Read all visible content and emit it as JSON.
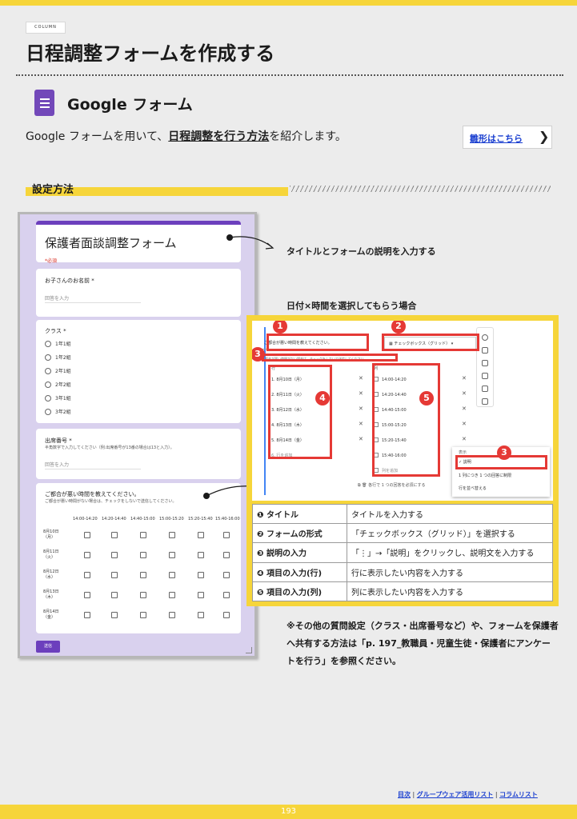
{
  "column_tag": "COLUMN",
  "page_title": "日程調整フォームを作成する",
  "app_name": "Google フォーム",
  "intro": {
    "prefix": "Google フォームを用いて、",
    "highlight": "日程調整を行う方法",
    "suffix": "を紹介します。"
  },
  "template_button": {
    "label": "雛形はこちら",
    "chevron": "❯"
  },
  "section_title": "設定方法",
  "form": {
    "title": "保護者面談調整フォーム",
    "required_note": "*必須",
    "q1": {
      "label": "お子さんのお名前 *",
      "placeholder": "回答を入力"
    },
    "q2": {
      "label": "クラス *",
      "options": [
        "1年1組",
        "1年2組",
        "2年1組",
        "2年2組",
        "3年1組",
        "3年2組"
      ]
    },
    "q3": {
      "label": "出席番号 *",
      "help": "半角数字で入力してください（例:出席番号が13番の場合は13と入力）。",
      "placeholder": "回答を入力"
    },
    "q4": {
      "label": "ご都合が悪い時間を教えてください。",
      "help": "ご都合が悪い時間がない場合は、チェックをしないで送信してください。",
      "columns": [
        "14:00-14:20",
        "14:20-14:40",
        "14:40-15:00",
        "15:00-15:20",
        "15:20-15:40",
        "15:40-16:00"
      ],
      "rows": [
        "8月10日（月）",
        "8月11日（火）",
        "8月12日（水）",
        "8月13日（木）",
        "8月14日（金）"
      ]
    },
    "submit": "送信"
  },
  "annotation_title": "タイトルとフォームの説明を入力する",
  "annotation_grid": "日付×時間を選択してもらう場合",
  "editor": {
    "question": "ご都合が悪い時間を教えてください。",
    "type": "チェックボックス（グリッド）",
    "description": "ご都合が悪い時間がない場合は、チェックをしないで送信してください。",
    "rows_header": "行",
    "cols_header": "列",
    "rows": [
      "1. 8月10日（月）",
      "2. 8月11日（火）",
      "3. 8月12日（水）",
      "4. 8月13日（木）",
      "5. 8月14日（金）",
      "6. 行を追加"
    ],
    "cols": [
      "14:00-14:20",
      "14:20-14:40",
      "14:40-15:00",
      "15:00-15:20",
      "15:20-15:40",
      "15:40-16:00",
      "列を追加"
    ],
    "menu_header": "表示",
    "menu": [
      "説明",
      "1 列につき 1 つの回答に制限",
      "行を並べ替える"
    ],
    "footer": "各行で 1 つの回答を必須にする"
  },
  "steps": [
    {
      "num": "❶",
      "key": "タイトル",
      "desc": "タイトルを入力する"
    },
    {
      "num": "❷",
      "key": "フォームの形式",
      "desc": "「チェックボックス（グリッド）」を選択する"
    },
    {
      "num": "❸",
      "key": "説明の入力",
      "desc": "「⋮」→「説明」をクリックし、説明文を入力する"
    },
    {
      "num": "❹",
      "key": "項目の入力(行)",
      "desc": "行に表示したい内容を入力する"
    },
    {
      "num": "❺",
      "key": "項目の入力(列)",
      "desc": "列に表示したい内容を入力する"
    }
  ],
  "badges": [
    "1",
    "2",
    "3",
    "4",
    "5",
    "3"
  ],
  "note": "※その他の質問設定（クラス・出席番号など）や、フォームを保護者へ共有する方法は「p. 197_教職員・児童生徒・保護者にアンケートを行う」を参照ください。",
  "footer_links": [
    "目次",
    "グループウェア活用リスト",
    "コラムリスト"
  ],
  "footer_sep": "|",
  "page_number": "193",
  "colors": {
    "accent_yellow": "#f6d53a",
    "forms_purple": "#7248b9",
    "red": "#e53935",
    "link_blue": "#1a3fd0"
  }
}
